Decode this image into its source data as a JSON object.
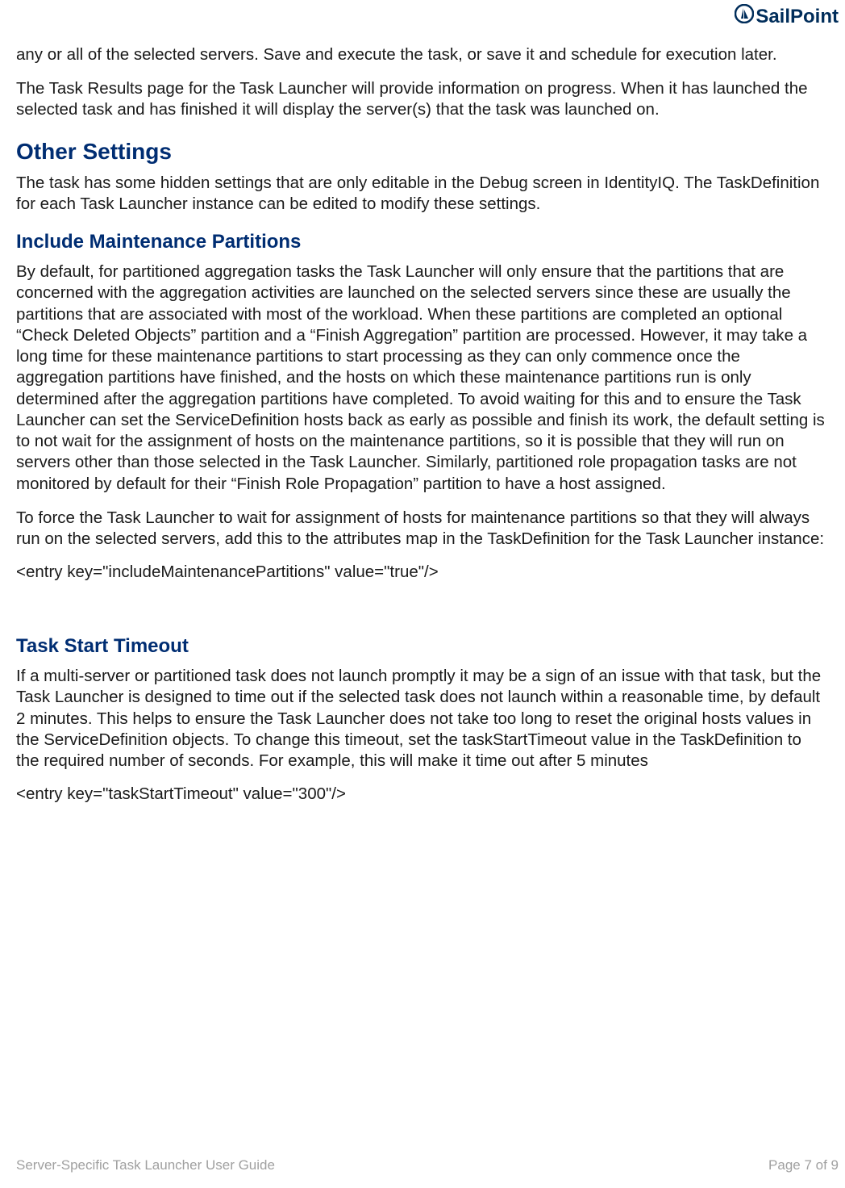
{
  "brand": {
    "name": "SailPoint"
  },
  "content": {
    "p1": "any or all of the selected servers.  Save and execute the task, or save it and schedule for execution later.",
    "p2": "The Task Results page for the Task Launcher will provide information on progress.  When it has launched the selected task and has finished it will display the server(s) that the task was launched on.",
    "h1": "Other Settings",
    "p3": "The task has some hidden settings that are only editable in the Debug screen in IdentityIQ.  The TaskDefinition for each Task Launcher instance can be edited to modify these settings.",
    "h2a": "Include Maintenance Partitions",
    "p4": "By default, for partitioned aggregation tasks the Task Launcher will only ensure that the partitions that are concerned with the aggregation activities are launched on the selected servers since these are usually the partitions that are associated with most of the workload.  When these partitions are completed an optional “Check Deleted Objects” partition and a “Finish Aggregation” partition are processed.  However, it may take a long time for these maintenance partitions to start processing as they can only commence once the aggregation partitions have finished, and the hosts on which these maintenance partitions run is only determined after the aggregation partitions have completed.  To avoid waiting for this and to ensure the Task Launcher can set the ServiceDefinition hosts back as early as possible and finish its work, the default setting is to not wait for the assignment of hosts on the maintenance partitions, so it is possible that they will run on servers other than those selected in the Task Launcher.  Similarly, partitioned role propagation tasks are not monitored by default for their “Finish Role Propagation” partition to have a host assigned.",
    "p5": "To force the Task Launcher to wait for assignment of hosts for maintenance partitions so that they will always run on the selected servers, add this to the attributes map in the TaskDefinition for the Task Launcher instance:",
    "code1": "<entry key=\"includeMaintenancePartitions\" value=\"true\"/>",
    "h2b": "Task Start Timeout",
    "p6": "If a multi-server or partitioned task does not launch promptly it may be a sign of an issue with that task, but the Task Launcher is designed to time out if the selected task does not launch within a reasonable time, by default 2 minutes.  This helps to ensure the Task Launcher does not take too long to reset the original hosts values in the ServiceDefinition objects. To change this timeout, set the taskStartTimeout value in the TaskDefinition to the required number of seconds.  For example, this will make it time out after 5 minutes",
    "code2": "<entry key=\"taskStartTimeout\" value=\"300\"/>"
  },
  "footer": {
    "left": "Server-Specific Task Launcher User Guide",
    "right": "Page 7 of 9"
  }
}
